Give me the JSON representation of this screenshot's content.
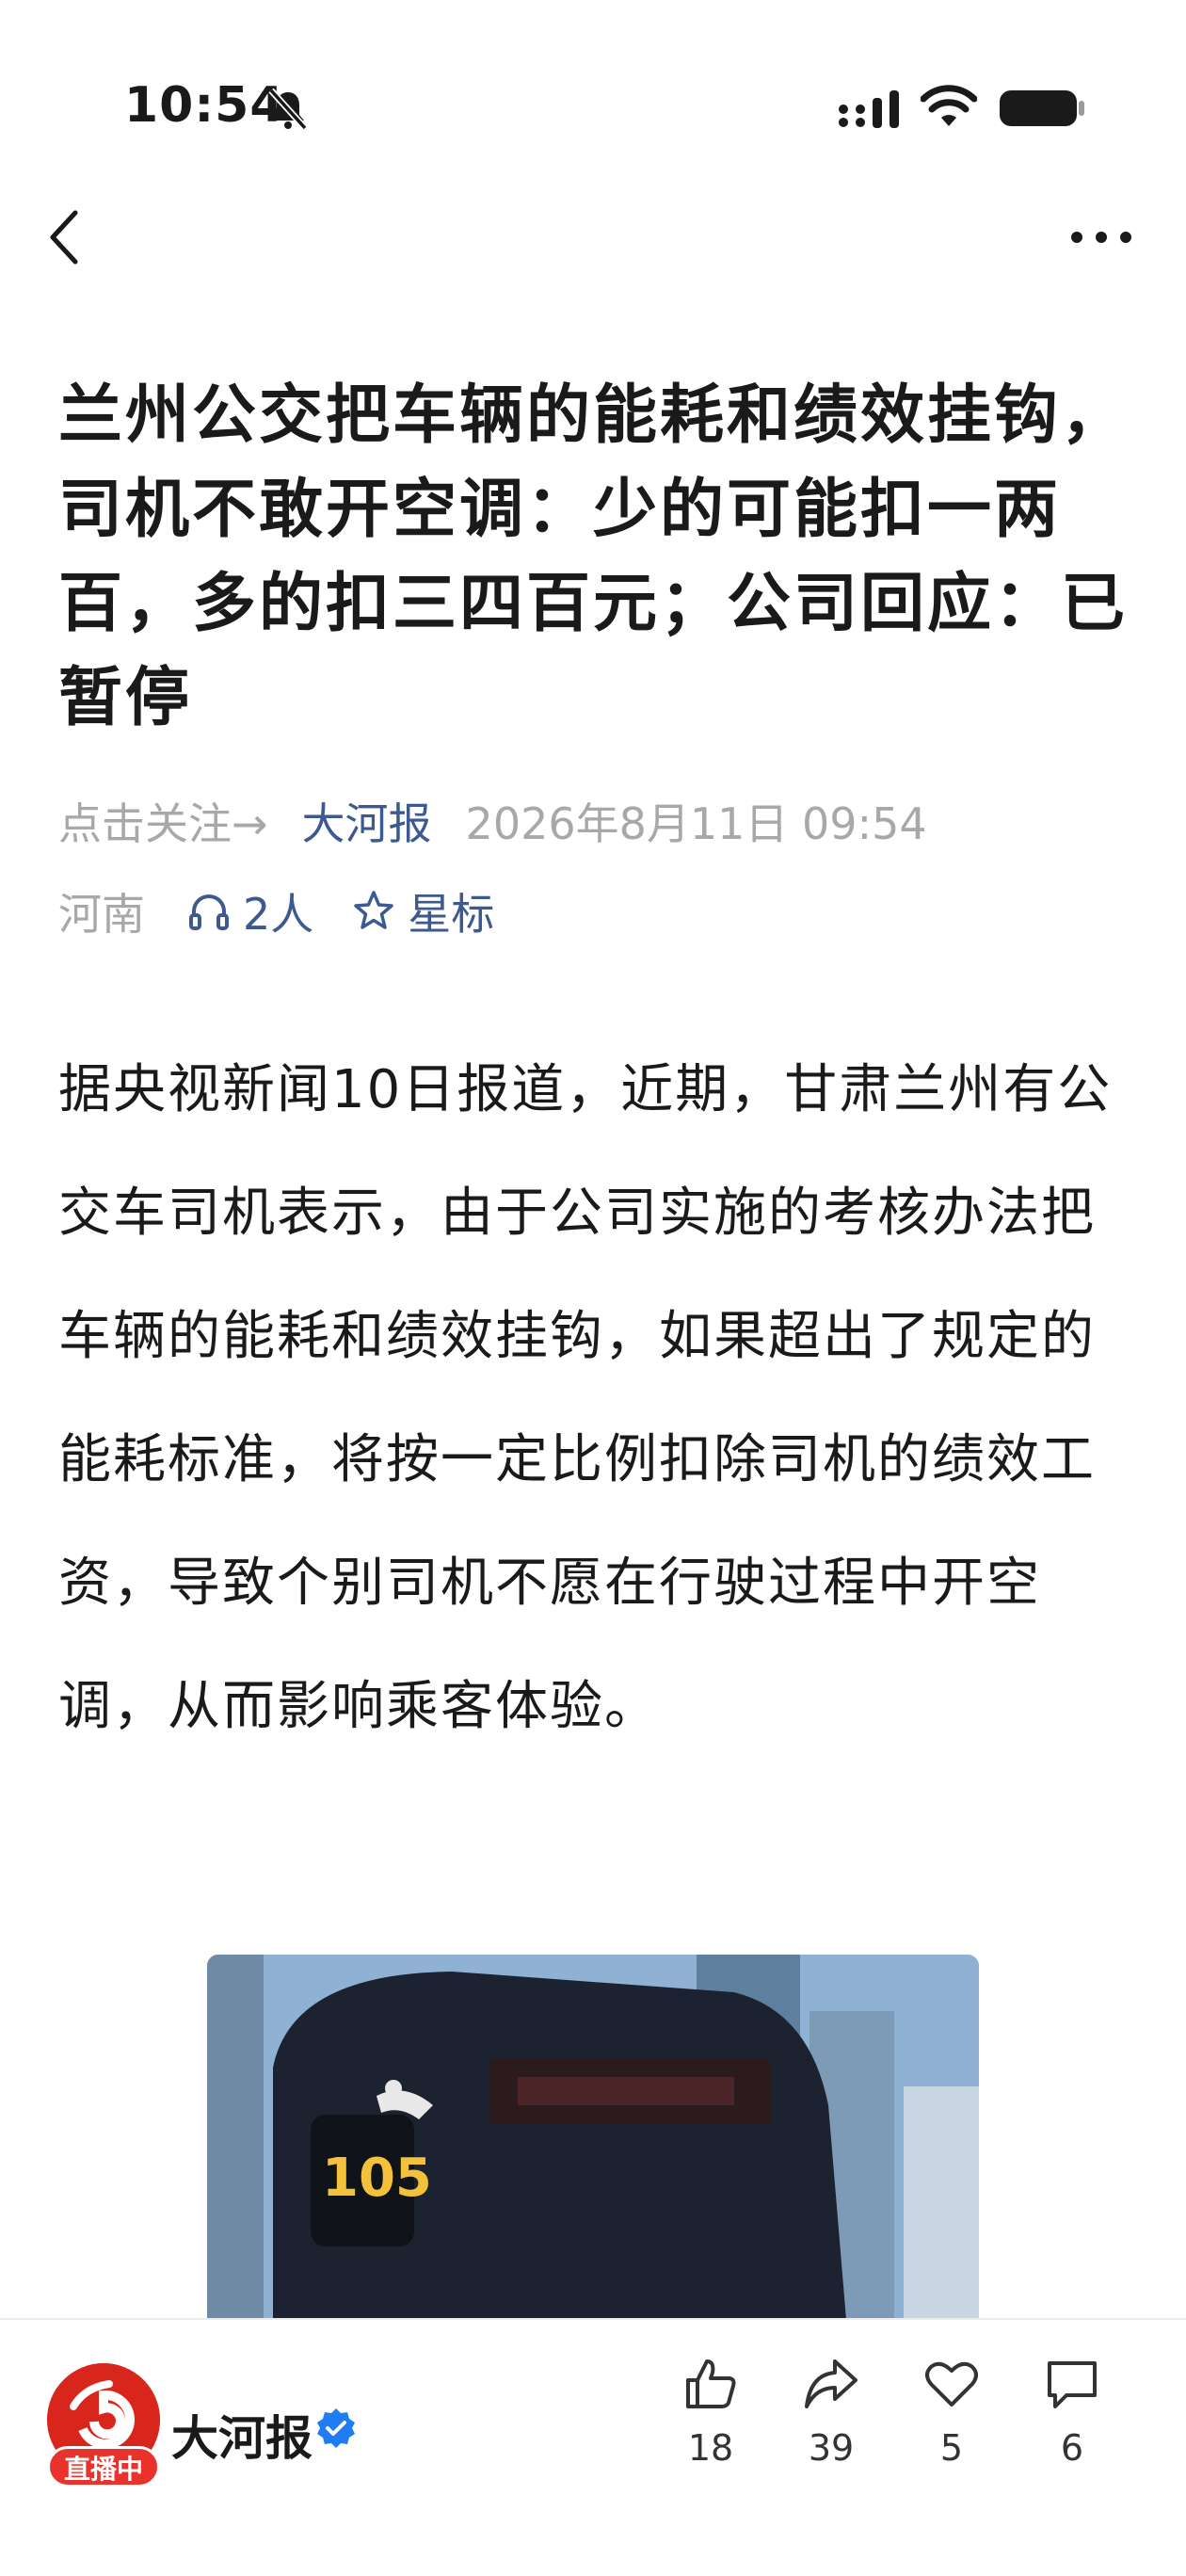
{
  "status_bar": {
    "time": "10:54"
  },
  "article": {
    "headline": "兰州公交把车辆的能耗和绩效挂钩，司机不敢开空调：少的可能扣一两百，多的扣三四百元；公司回应：已暂停",
    "follow_label": "点击关注→",
    "source": "大河报",
    "date": "2026年8月11日 09:54",
    "region": "河南",
    "listeners": "2人",
    "star_label": "星标",
    "body": "据央视新闻10日报道，近期，甘肃兰州有公交车司机表示，由于公司实施的考核办法把车辆的能耗和绩效挂钩，如果超出了规定的能耗标准，将按一定比例扣除司机的绩效工资，导致个别司机不愿在行驶过程中开空调，从而影响乘客体验。",
    "image": {
      "bus_route": "105"
    }
  },
  "bottom_bar": {
    "live_badge": "直播中",
    "channel_name": "大河报",
    "likes": "18",
    "shares": "39",
    "favorites": "5",
    "comments": "6"
  },
  "colors": {
    "accent": "#3c5a91",
    "meta_gray": "#a8a8a8",
    "live_red": "#e8322b",
    "verified_blue": "#1f7cf2"
  }
}
